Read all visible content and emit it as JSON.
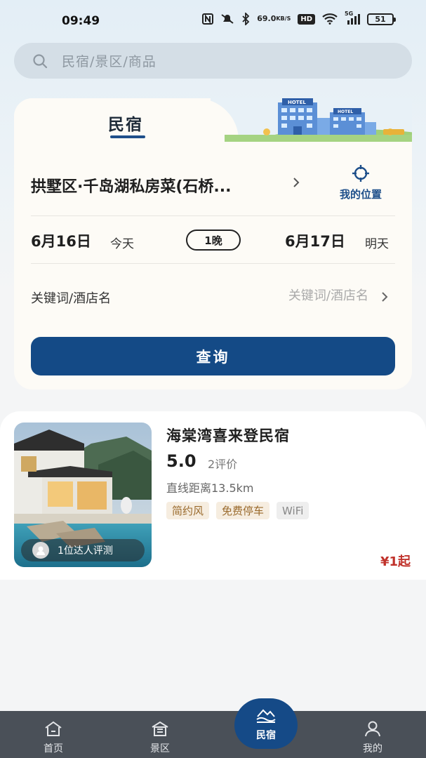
{
  "status_bar": {
    "time": "09:49",
    "net_speed_value": "69.0",
    "net_speed_unit": "KB/S",
    "hd": "HD",
    "signal": "5G",
    "battery": "51"
  },
  "search": {
    "placeholder": "民宿/景区/商品"
  },
  "booking": {
    "tab_label": "民宿",
    "location": "拱墅区·千岛湖私房菜(石桥...",
    "my_location_label": "我的位置",
    "checkin_date": "6月16日",
    "checkin_day": "今天",
    "nights": "1晚",
    "checkout_date": "6月17日",
    "checkout_day": "明天",
    "keyword_label": "关键词/酒店名",
    "keyword_placeholder": "关键词/酒店名",
    "query_button": "查询"
  },
  "listings": [
    {
      "name": "海棠湾喜来登民宿",
      "rating": "5.0",
      "reviews": "2评价",
      "distance": "直线距离13.5km",
      "tags": [
        "简约风",
        "免费停车",
        "WiFi"
      ],
      "reviewer_badge": "1位达人评测",
      "price": "¥1起"
    }
  ],
  "bottom_nav": {
    "items": [
      {
        "label": "首页",
        "icon": "home-icon"
      },
      {
        "label": "景区",
        "icon": "scenic-icon"
      },
      {
        "label": "民宿",
        "icon": "homestay-icon",
        "active": true
      },
      {
        "label": "我的",
        "icon": "profile-icon"
      }
    ]
  },
  "colors": {
    "brand_blue": "#144a86",
    "price_red": "#c0322b",
    "nav_bg": "#4a5058"
  }
}
